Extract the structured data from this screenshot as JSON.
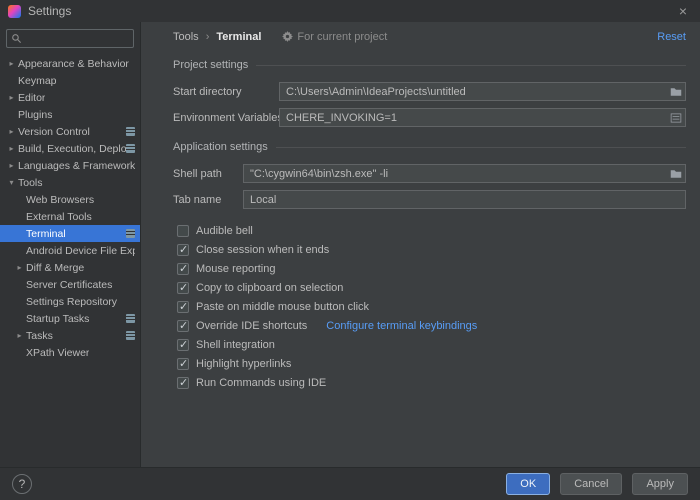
{
  "window": {
    "title": "Settings",
    "close_glyph": "×"
  },
  "sidebar": {
    "search": {
      "value": "",
      "placeholder": ""
    },
    "items": [
      {
        "arrow": "▸",
        "label": "Appearance & Behavior",
        "level": 0,
        "scoped": false,
        "selected": false
      },
      {
        "arrow": "",
        "label": "Keymap",
        "level": 0,
        "scoped": false,
        "selected": false
      },
      {
        "arrow": "▸",
        "label": "Editor",
        "level": 0,
        "scoped": false,
        "selected": false
      },
      {
        "arrow": "",
        "label": "Plugins",
        "level": 0,
        "scoped": false,
        "selected": false
      },
      {
        "arrow": "▸",
        "label": "Version Control",
        "level": 0,
        "scoped": true,
        "selected": false
      },
      {
        "arrow": "▸",
        "label": "Build, Execution, Deployment",
        "level": 0,
        "scoped": true,
        "selected": false
      },
      {
        "arrow": "▸",
        "label": "Languages & Frameworks",
        "level": 0,
        "scoped": false,
        "selected": false
      },
      {
        "arrow": "▾",
        "label": "Tools",
        "level": 0,
        "scoped": false,
        "selected": false
      },
      {
        "arrow": "",
        "label": "Web Browsers",
        "level": 1,
        "scoped": false,
        "selected": false
      },
      {
        "arrow": "",
        "label": "External Tools",
        "level": 1,
        "scoped": false,
        "selected": false
      },
      {
        "arrow": "",
        "label": "Terminal",
        "level": 1,
        "scoped": true,
        "selected": true
      },
      {
        "arrow": "",
        "label": "Android Device File Explorer",
        "level": 1,
        "scoped": false,
        "selected": false
      },
      {
        "arrow": "▸",
        "label": "Diff & Merge",
        "level": 1,
        "scoped": false,
        "selected": false
      },
      {
        "arrow": "",
        "label": "Server Certificates",
        "level": 1,
        "scoped": false,
        "selected": false
      },
      {
        "arrow": "",
        "label": "Settings Repository",
        "level": 1,
        "scoped": false,
        "selected": false
      },
      {
        "arrow": "",
        "label": "Startup Tasks",
        "level": 1,
        "scoped": true,
        "selected": false
      },
      {
        "arrow": "▸",
        "label": "Tasks",
        "level": 1,
        "scoped": true,
        "selected": false
      },
      {
        "arrow": "",
        "label": "XPath Viewer",
        "level": 1,
        "scoped": false,
        "selected": false
      }
    ]
  },
  "header": {
    "breadcrumb": [
      "Tools",
      "Terminal"
    ],
    "separator": "›",
    "scope_note": "For current project",
    "reset_label": "Reset"
  },
  "project_settings": {
    "title": "Project settings",
    "fields": [
      {
        "label": "Start directory",
        "value": "C:\\Users\\Admin\\IdeaProjects\\untitled"
      },
      {
        "label": "Environment Variables",
        "value": "CHERE_INVOKING=1"
      }
    ]
  },
  "application_settings": {
    "title": "Application settings",
    "fields": [
      {
        "label": "Shell path",
        "value": "\"C:\\cygwin64\\bin\\zsh.exe\" -li"
      },
      {
        "label": "Tab name",
        "value": "Local"
      }
    ],
    "checkboxes": [
      {
        "label": "Audible bell",
        "checked": false
      },
      {
        "label": "Close session when it ends",
        "checked": true
      },
      {
        "label": "Mouse reporting",
        "checked": true
      },
      {
        "label": "Copy to clipboard on selection",
        "checked": true
      },
      {
        "label": "Paste on middle mouse button click",
        "checked": true
      },
      {
        "label": "Override IDE shortcuts",
        "checked": true,
        "link": "Configure terminal keybindings"
      },
      {
        "label": "Shell integration",
        "checked": true
      },
      {
        "label": "Highlight hyperlinks",
        "checked": true
      },
      {
        "label": "Run Commands using IDE",
        "checked": true
      }
    ]
  },
  "footer": {
    "help": "?",
    "ok": "OK",
    "cancel": "Cancel",
    "apply": "Apply"
  },
  "colors": {
    "selection": "#3875d6",
    "link": "#589df6",
    "ok_button": "#3d6dbf"
  }
}
